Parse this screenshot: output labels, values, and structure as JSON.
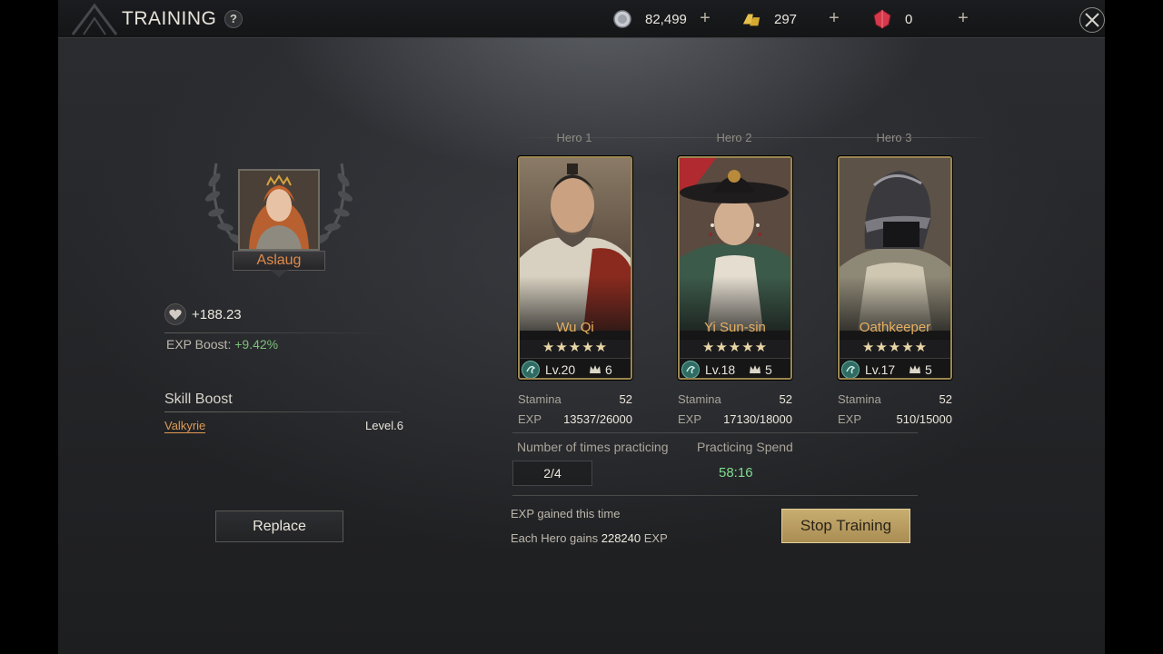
{
  "header": {
    "title": "TRAINING",
    "help_label": "?",
    "resources": [
      {
        "name": "silver",
        "value": "82,499",
        "icon": "silver-coin-icon"
      },
      {
        "name": "gold",
        "value": "297",
        "icon": "gold-bars-icon"
      },
      {
        "name": "gem",
        "value": "0",
        "icon": "ruby-gem-icon"
      }
    ],
    "plus_label": "+"
  },
  "left": {
    "commander_name": "Aslaug",
    "power_value": "+188.23",
    "exp_boost_label": "EXP Boost: ",
    "exp_boost_value": "+9.42%",
    "skill_boost_title": "Skill Boost",
    "skill_name": "Valkyrie",
    "skill_level": "Level.6",
    "replace_label": "Replace"
  },
  "heroes": [
    {
      "slot": "Hero 1",
      "name": "Wu Qi",
      "stars": "★★★★★",
      "level": "Lv.20",
      "rank": "6",
      "stamina_label": "Stamina",
      "stamina": "52",
      "exp_label": "EXP",
      "exp": "13537/26000"
    },
    {
      "slot": "Hero 2",
      "name": "Yi Sun-sin",
      "stars": "★★★★★",
      "level": "Lv.18",
      "rank": "5",
      "stamina_label": "Stamina",
      "stamina": "52",
      "exp_label": "EXP",
      "exp": "17130/18000"
    },
    {
      "slot": "Hero 3",
      "name": "Oathkeeper",
      "stars": "★★★★★",
      "level": "Lv.17",
      "rank": "5",
      "stamina_label": "Stamina",
      "stamina": "52",
      "exp_label": "EXP",
      "exp": "510/15000"
    }
  ],
  "practice": {
    "times_label": "Number of times practicing",
    "times_value": "2/4",
    "spend_label": "Practicing Spend",
    "spend_value": "58:16",
    "exp_gained_label": "EXP gained this time",
    "each_gains_prefix": "Each Hero gains ",
    "each_gains_value": "228240",
    "each_gains_suffix": " EXP",
    "stop_label": "Stop Training"
  },
  "colors": {
    "accent_gold": "#c8ad70",
    "name_orange": "#e08a4a",
    "boost_green": "#7cc07a",
    "timer_green": "#7fdc8e",
    "hero_name": "#e6b060"
  }
}
